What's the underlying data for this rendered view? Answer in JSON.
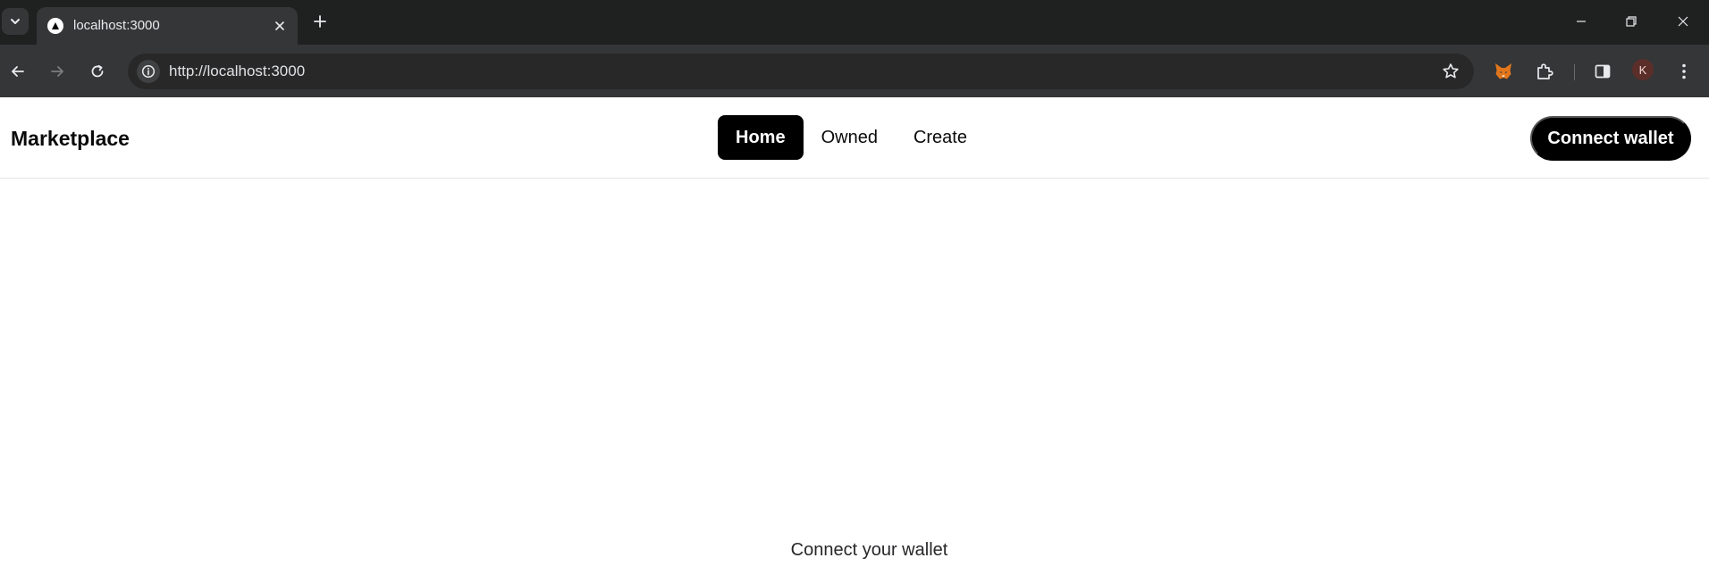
{
  "browser": {
    "tab_title": "localhost:3000",
    "url": "http://localhost:3000",
    "profile_initial": "K"
  },
  "icons": {
    "tab_search": "chevron-down-icon",
    "favicon": "triangle-icon",
    "tab_close": "close-icon",
    "new_tab": "plus-icon",
    "minimize": "minimize-icon",
    "restore": "restore-icon",
    "close_window": "close-icon",
    "back": "arrow-left-icon",
    "forward": "arrow-right-icon",
    "reload": "reload-icon",
    "site_info": "info-icon",
    "bookmark": "star-icon",
    "metamask": "fox-icon",
    "extensions": "puzzle-icon",
    "side_panel": "side-panel-icon",
    "menu": "kebab-menu-icon"
  },
  "app": {
    "brand": "Marketplace",
    "nav": [
      {
        "label": "Home",
        "active": true
      },
      {
        "label": "Owned",
        "active": false
      },
      {
        "label": "Create",
        "active": false
      }
    ],
    "connect_button": "Connect wallet",
    "empty_message": "Connect your wallet"
  },
  "colors": {
    "chrome_dark": "#1f2020",
    "toolbar": "#353637",
    "primary": "#000000",
    "background": "#ffffff"
  }
}
